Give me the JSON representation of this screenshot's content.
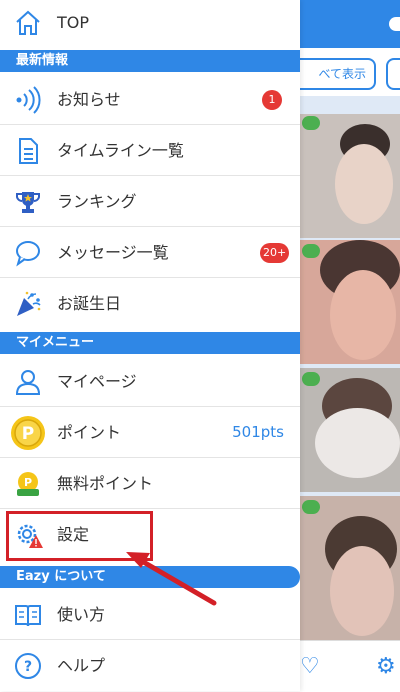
{
  "background": {
    "show_all_label": "べて表示"
  },
  "drawer": {
    "top_label": "TOP",
    "sections": {
      "news": "最新情報",
      "my_menu": "マイメニュー",
      "about": "Eazy について"
    },
    "news_items": [
      {
        "label": "お知らせ",
        "icon": "broadcast-icon",
        "badge": "1"
      },
      {
        "label": "タイムライン一覧",
        "icon": "document-icon"
      },
      {
        "label": "ランキング",
        "icon": "trophy-icon"
      },
      {
        "label": "メッセージ一覧",
        "icon": "speech-bubble-icon",
        "badge": "20+"
      },
      {
        "label": "お誕生日",
        "icon": "party-popper-icon"
      }
    ],
    "my_items": [
      {
        "label": "マイページ",
        "icon": "user-icon"
      },
      {
        "label": "ポイント",
        "icon": "point-coin-icon",
        "value": "501pts"
      },
      {
        "label": "無料ポイント",
        "icon": "free-point-icon"
      },
      {
        "label": "設定",
        "icon": "gear-warning-icon"
      }
    ],
    "about_items": [
      {
        "label": "使い方",
        "icon": "book-icon"
      },
      {
        "label": "ヘルプ",
        "icon": "help-icon"
      }
    ]
  },
  "colors": {
    "accent": "#2f87e6",
    "badge": "#e53935",
    "annotation": "#d32027"
  }
}
